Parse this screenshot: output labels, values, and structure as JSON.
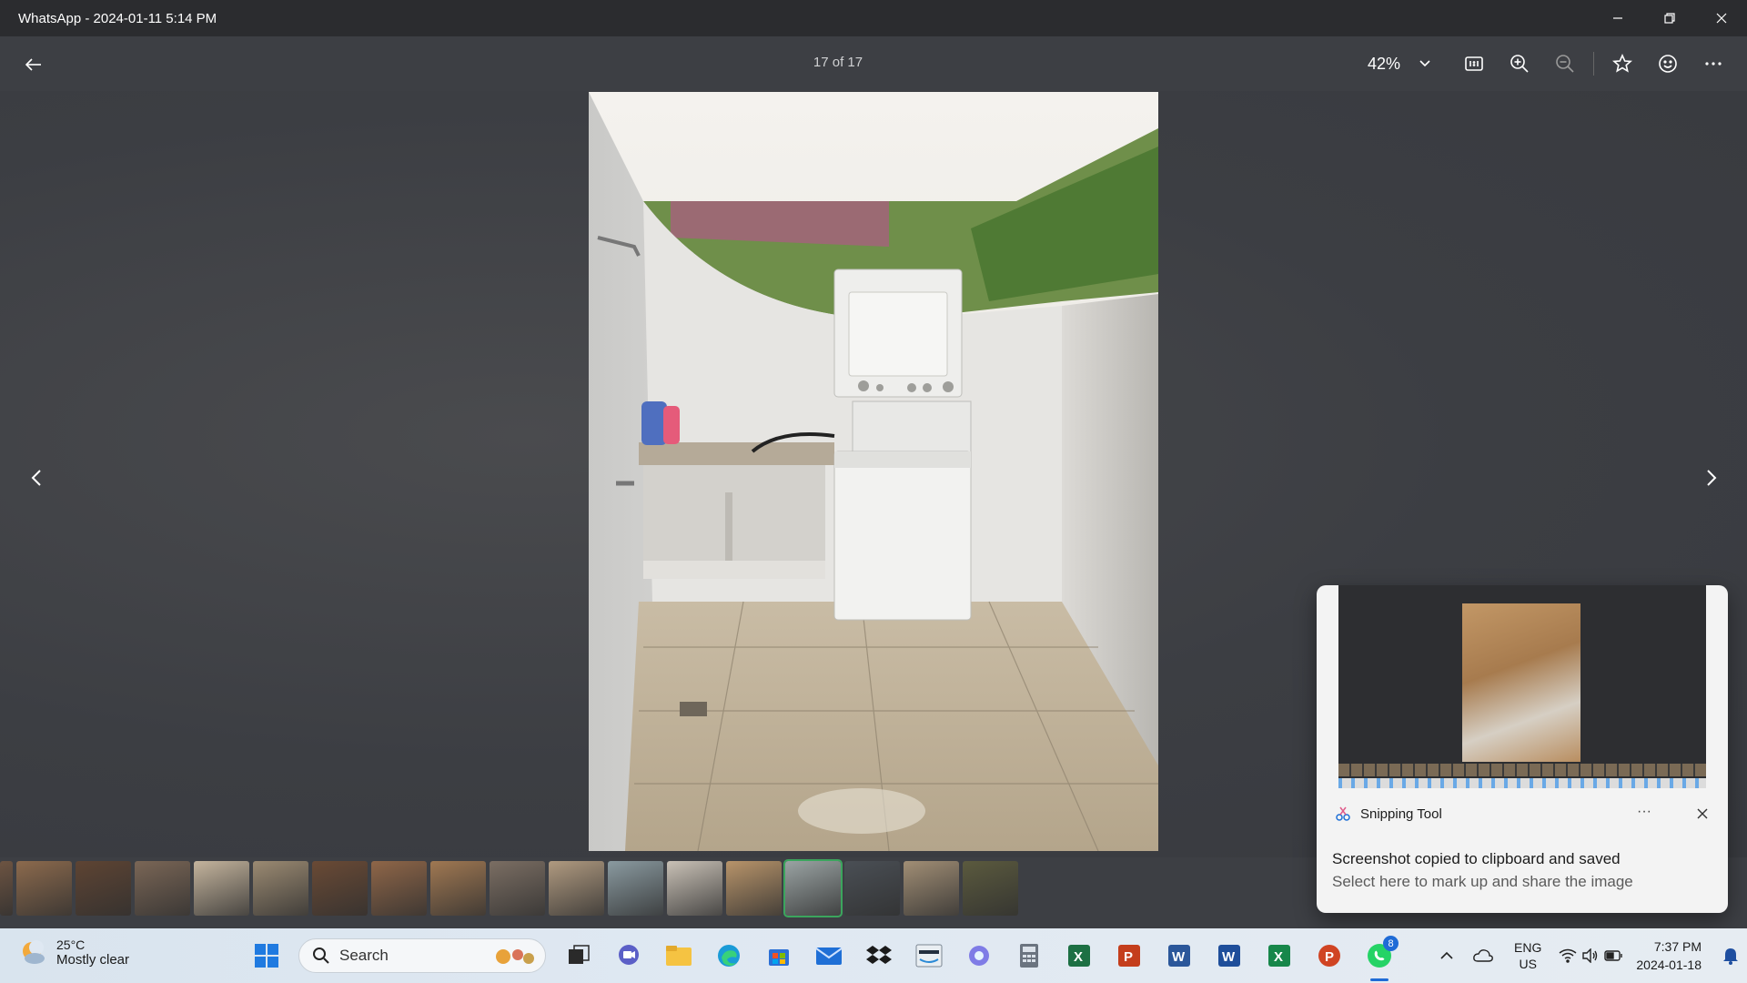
{
  "window": {
    "title": "WhatsApp - 2024-01-11 5:14 PM",
    "minimize_icon": "minimize-icon",
    "maximize_icon": "restore-icon",
    "close_icon": "close-icon"
  },
  "toolbar": {
    "counter": "17 of 17",
    "zoom": "42%",
    "icons": [
      "back-arrow-icon",
      "chevron-down-icon",
      "actual-size-icon",
      "zoom-in-icon",
      "zoom-out-icon",
      "star-icon",
      "smiley-icon",
      "more-icon"
    ]
  },
  "filmstrip": {
    "count": 18,
    "active_index": 14,
    "thumb_colors": [
      "#6d5442",
      "#8c6a4d",
      "#5e4433",
      "#7a6656",
      "#c4b49d",
      "#9b8a72",
      "#6a4a35",
      "#8f6648",
      "#a07852",
      "#7b6e63",
      "#b09a80",
      "#8a9aa0",
      "#c9c1b6",
      "#b8946a",
      "#9aa3a3",
      "#4a4f55",
      "#a18e75",
      "#5b5a3e"
    ]
  },
  "toast": {
    "app_name": "Snipping Tool",
    "more": "···",
    "title": "Screenshot copied to clipboard and saved",
    "body": "Select here to mark up and share the image"
  },
  "taskbar": {
    "weather_temp": "25°C",
    "weather_cond": "Mostly clear",
    "search_placeholder": "Search",
    "whatsapp_badge": "8",
    "lang_top": "ENG",
    "lang_bottom": "US",
    "time": "7:37 PM",
    "date": "2024-01-18",
    "colors": {
      "excel": "#1d7044",
      "powerpoint": "#c43e1c",
      "word": "#2b579a",
      "whatsapp": "#25d366",
      "edge": "#1a9bd7",
      "folder": "#f5c342"
    }
  }
}
